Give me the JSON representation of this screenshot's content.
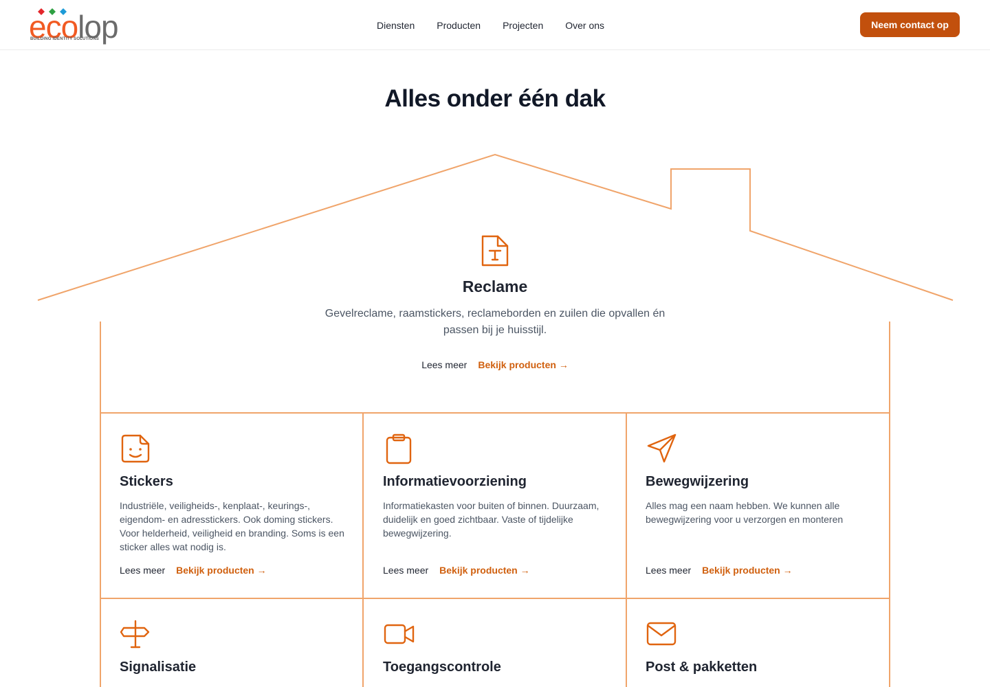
{
  "header": {
    "logo": {
      "text": "ecolop",
      "tagline": "BUILDING IDENTITY SOLUTIONS"
    },
    "nav": [
      "Diensten",
      "Producten",
      "Projecten",
      "Over ons"
    ],
    "cta_label": "Neem contact op"
  },
  "title": "Alles onder één dak",
  "featured": {
    "icon": "document-text-icon",
    "title": "Reclame",
    "description": "Gevelreclame, raamstickers, reclameborden en zuilen die opvallen én passen bij je huisstijl.",
    "more_label": "Lees meer",
    "products_label": "Bekijk producten →"
  },
  "cards": [
    {
      "icon": "sticker-icon",
      "title": "Stickers",
      "description": "Industriële, veiligheids-, kenplaat-, keurings-, eigendom- en adresstickers. Ook doming stickers. Voor helderheid, veiligheid en branding. Soms is een sticker alles wat nodig is.",
      "more_label": "Lees meer",
      "products_label": "Bekijk producten →"
    },
    {
      "icon": "clipboard-icon",
      "title": "Informatievoorziening",
      "description": "Informatiekasten voor buiten of binnen. Duurzaam, duidelijk en goed zichtbaar. Vaste of tijdelijke bewegwijzering.",
      "more_label": "Lees meer",
      "products_label": "Bekijk producten →"
    },
    {
      "icon": "navigation-arrow-icon",
      "title": "Bewegwijzering",
      "description": "Alles mag een naam hebben. We kunnen alle bewegwijzering voor u verzorgen en monteren",
      "more_label": "Lees meer",
      "products_label": "Bekijk producten →"
    },
    {
      "icon": "signpost-icon",
      "title": "Signalisatie"
    },
    {
      "icon": "video-camera-icon",
      "title": "Toegangscontrole"
    },
    {
      "icon": "envelope-icon",
      "title": "Post & pakketten"
    }
  ],
  "colors": {
    "accent": "#c2500d",
    "link": "#d0600f",
    "outline": "#f0a46a",
    "icon": "#e0640f"
  }
}
